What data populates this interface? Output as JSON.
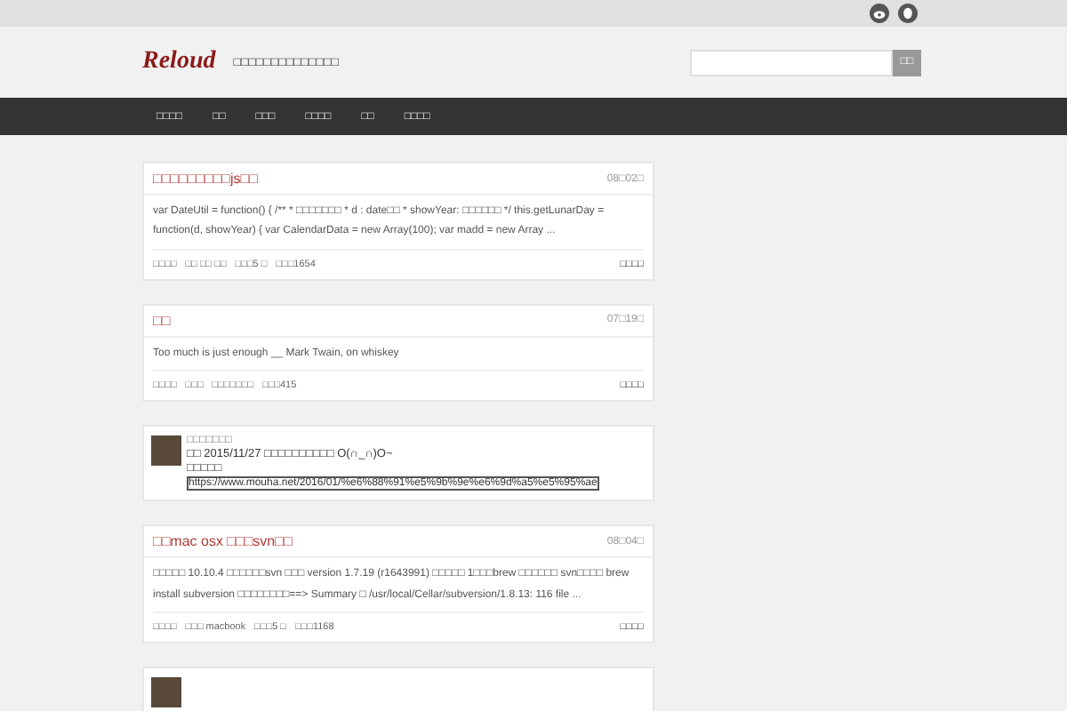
{
  "header": {
    "logo": "Reloud",
    "tagline": "□□□□□□□□□□□□□□",
    "search": {
      "button": "□□"
    }
  },
  "nav": [
    "□□□□",
    "□□",
    "□□□",
    "□□□□",
    "□□",
    "□□□□"
  ],
  "posts": [
    {
      "kind": "article",
      "title": "□□□□□□□□□js□□",
      "date": "08□02□",
      "excerpt": "var DateUtil = function() { /** * □□□□□□□ * d : date□□ * showYear: □□□□□□ */ this.getLunarDay = function(d, showYear) { var CalendarData = new Array(100); var madd = new Array ...",
      "meta": [
        "□□□□",
        "□□ □□ □□",
        "□□□5 □",
        "□□□1654"
      ],
      "more": "□□□□"
    },
    {
      "kind": "article",
      "title": "□□",
      "date": "07□19□",
      "excerpt": "Too much is just enough __ Mark Twain, on whiskey",
      "meta": [
        "□□□□",
        "□□□",
        "□□□□□□□",
        "□□□415"
      ],
      "more": "□□□□"
    },
    {
      "kind": "status",
      "author": "□□□□□□□",
      "lines": [
        "□□ 2015/11/27 □□□□□□□□□□ O(∩_∩)O~",
        "□□□□□"
      ],
      "link": "https://www.mouha.net/2016/01/%e6%88%91%e5%9b%9e%e6%9d%a5%e5%95%ae"
    },
    {
      "kind": "article",
      "title": "□□mac osx □□□svn□□",
      "date": "08□04□",
      "excerpt": "□□□□□ 10.10.4 □□□□□□svn □□□ version 1.7.19 (r1643991) □□□□□ 1□□□brew □□□□□□ svn□□□□ brew install subversion □□□□□□□□==> Summary □ /usr/local/Cellar/subversion/1.8.13: 116 file ...",
      "meta": [
        "□□□□",
        "□□□ macbook",
        "□□□5 □",
        "□□□1168"
      ],
      "more": "□□□□"
    },
    {
      "kind": "status"
    }
  ]
}
